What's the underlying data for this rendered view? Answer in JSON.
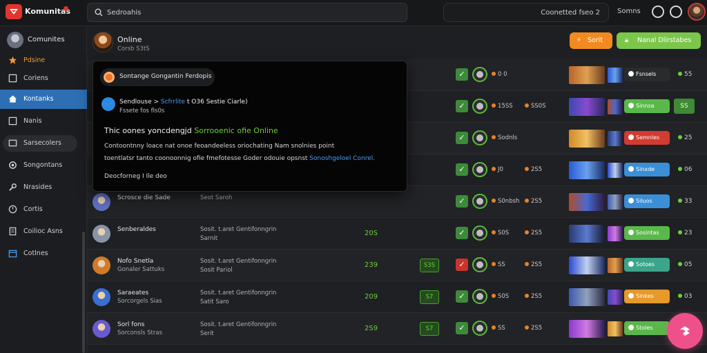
{
  "app": {
    "brand": "Komunitas"
  },
  "search": {
    "placeholder": "Sedroahis"
  },
  "topbar": {
    "connection_label": "Coonetted fseo 2",
    "link_label": "Somns"
  },
  "sidebar": {
    "user_name": "Comunites",
    "items": [
      {
        "label": "Pdsine"
      },
      {
        "label": "Coriens"
      },
      {
        "label": "Kontanks"
      },
      {
        "label": "Nanis"
      },
      {
        "label": "Sarsecolers"
      },
      {
        "label": "Songontans"
      },
      {
        "label": "Nrasides"
      },
      {
        "label": "Cortis"
      },
      {
        "label": "Coilioc Asns"
      },
      {
        "label": "Cotlnes"
      }
    ]
  },
  "header": {
    "title": "Online",
    "subtitle": "Corsb S3tS",
    "orange_button": "Sorit",
    "green_button": "Nanal Dlirstabes"
  },
  "popup": {
    "chip": "Sontange Gongantin Ferdopis",
    "line1_a": "Sendlouse >",
    "line1_b": "Scfrrlite",
    "line1_c": "t O36 Sestie Ciarle)",
    "line2": "Fssete fos fIs0s",
    "heading_a": "Thic oones yoncdengjd",
    "heading_b": "Sorrooenic ofie Online",
    "para1": "Contoontnny loace nat onoe feoandeeless oriochating Nam snolnies point",
    "para2_a": "toentlatsr tanto coonoonnig ofie fmefotesse Goder odouie opsnst",
    "para2_b": "Sonoshgeloel Conrel.",
    "footer": "Deocforneg I Ile deo"
  },
  "rows": [
    {
      "name": "",
      "namesub": "",
      "desc1": "",
      "desc2": "",
      "score": "",
      "badge": "",
      "st1": "0 0",
      "st2": "",
      "tag": "Fsnsels",
      "tagcolor": "#2a2b2d",
      "end": "55"
    },
    {
      "name": "",
      "namesub": "",
      "desc1": "",
      "desc2": "",
      "score": "",
      "badge": "",
      "st1": "15SS",
      "st2": "SS0S",
      "tag": "Sinnsa",
      "tagcolor": "#5ab84a",
      "end": "SS"
    },
    {
      "name": "",
      "namesub": "",
      "desc1": "",
      "desc2": "",
      "score": "",
      "badge": "",
      "st1": "Sodnls",
      "st2": "",
      "tag": "Semnles",
      "tagcolor": "#d13b30",
      "end": "25"
    },
    {
      "name": "",
      "namesub": "",
      "desc1": "",
      "desc2": "",
      "score": "",
      "badge": "",
      "st1": "J0",
      "st2": "2S5",
      "tag": "Sinxde",
      "tagcolor": "#3a8fd6",
      "end": "06"
    },
    {
      "name": "Scrosce die Sade",
      "namesub": "",
      "desc1": "Seot Saroh",
      "desc2": "",
      "score": "",
      "badge": "",
      "st1": "S0nbsh",
      "st2": "2S5",
      "tag": "Siluos",
      "tagcolor": "#3a8fd6",
      "end": "33"
    },
    {
      "name": "Senberaldes",
      "namesub": "",
      "desc1": "Sosit. t.aret Gentifonngrin",
      "desc2": "Sarnit",
      "score": "20S",
      "badge": "",
      "st1": "S0S",
      "st2": "2S5",
      "tag": "Sosintas",
      "tagcolor": "#5ab84a",
      "end": "23"
    },
    {
      "name": "Nofo Snetla",
      "namesub": "Gonaler Sattuks",
      "desc1": "Sosit. t.aret Gentifonngrin",
      "desc2": "Sosit Pariol",
      "score": "239",
      "badge": "S3S",
      "st1": "SS",
      "st2": "2S5",
      "tag": "Sotoes",
      "tagcolor": "#3aa58a",
      "end": "05"
    },
    {
      "name": "Saraeates",
      "namesub": "Sorcorgels Sias",
      "desc1": "Sosit. t.aret Gentifonngrin",
      "desc2": "Satit Saro",
      "score": "209",
      "badge": "S7",
      "st1": "S0S",
      "st2": "2S5",
      "tag": "Sinkes",
      "tagcolor": "#e59a2a",
      "end": "03"
    },
    {
      "name": "Sorl fons",
      "namesub": "Sorconsls Stras",
      "desc1": "Sosit. t.aret Gentifonngrin",
      "desc2": "Serit",
      "score": "2S9",
      "badge": "S7",
      "st1": "SS",
      "st2": "2S5",
      "tag": "Stoles",
      "tagcolor": "#5ab84a",
      "end": ""
    }
  ],
  "colors": {
    "accent_blue": "#2d6fb5",
    "accent_green": "#6ccf3a",
    "accent_orange": "#f38a1f",
    "fab_pink": "#f0508a"
  }
}
